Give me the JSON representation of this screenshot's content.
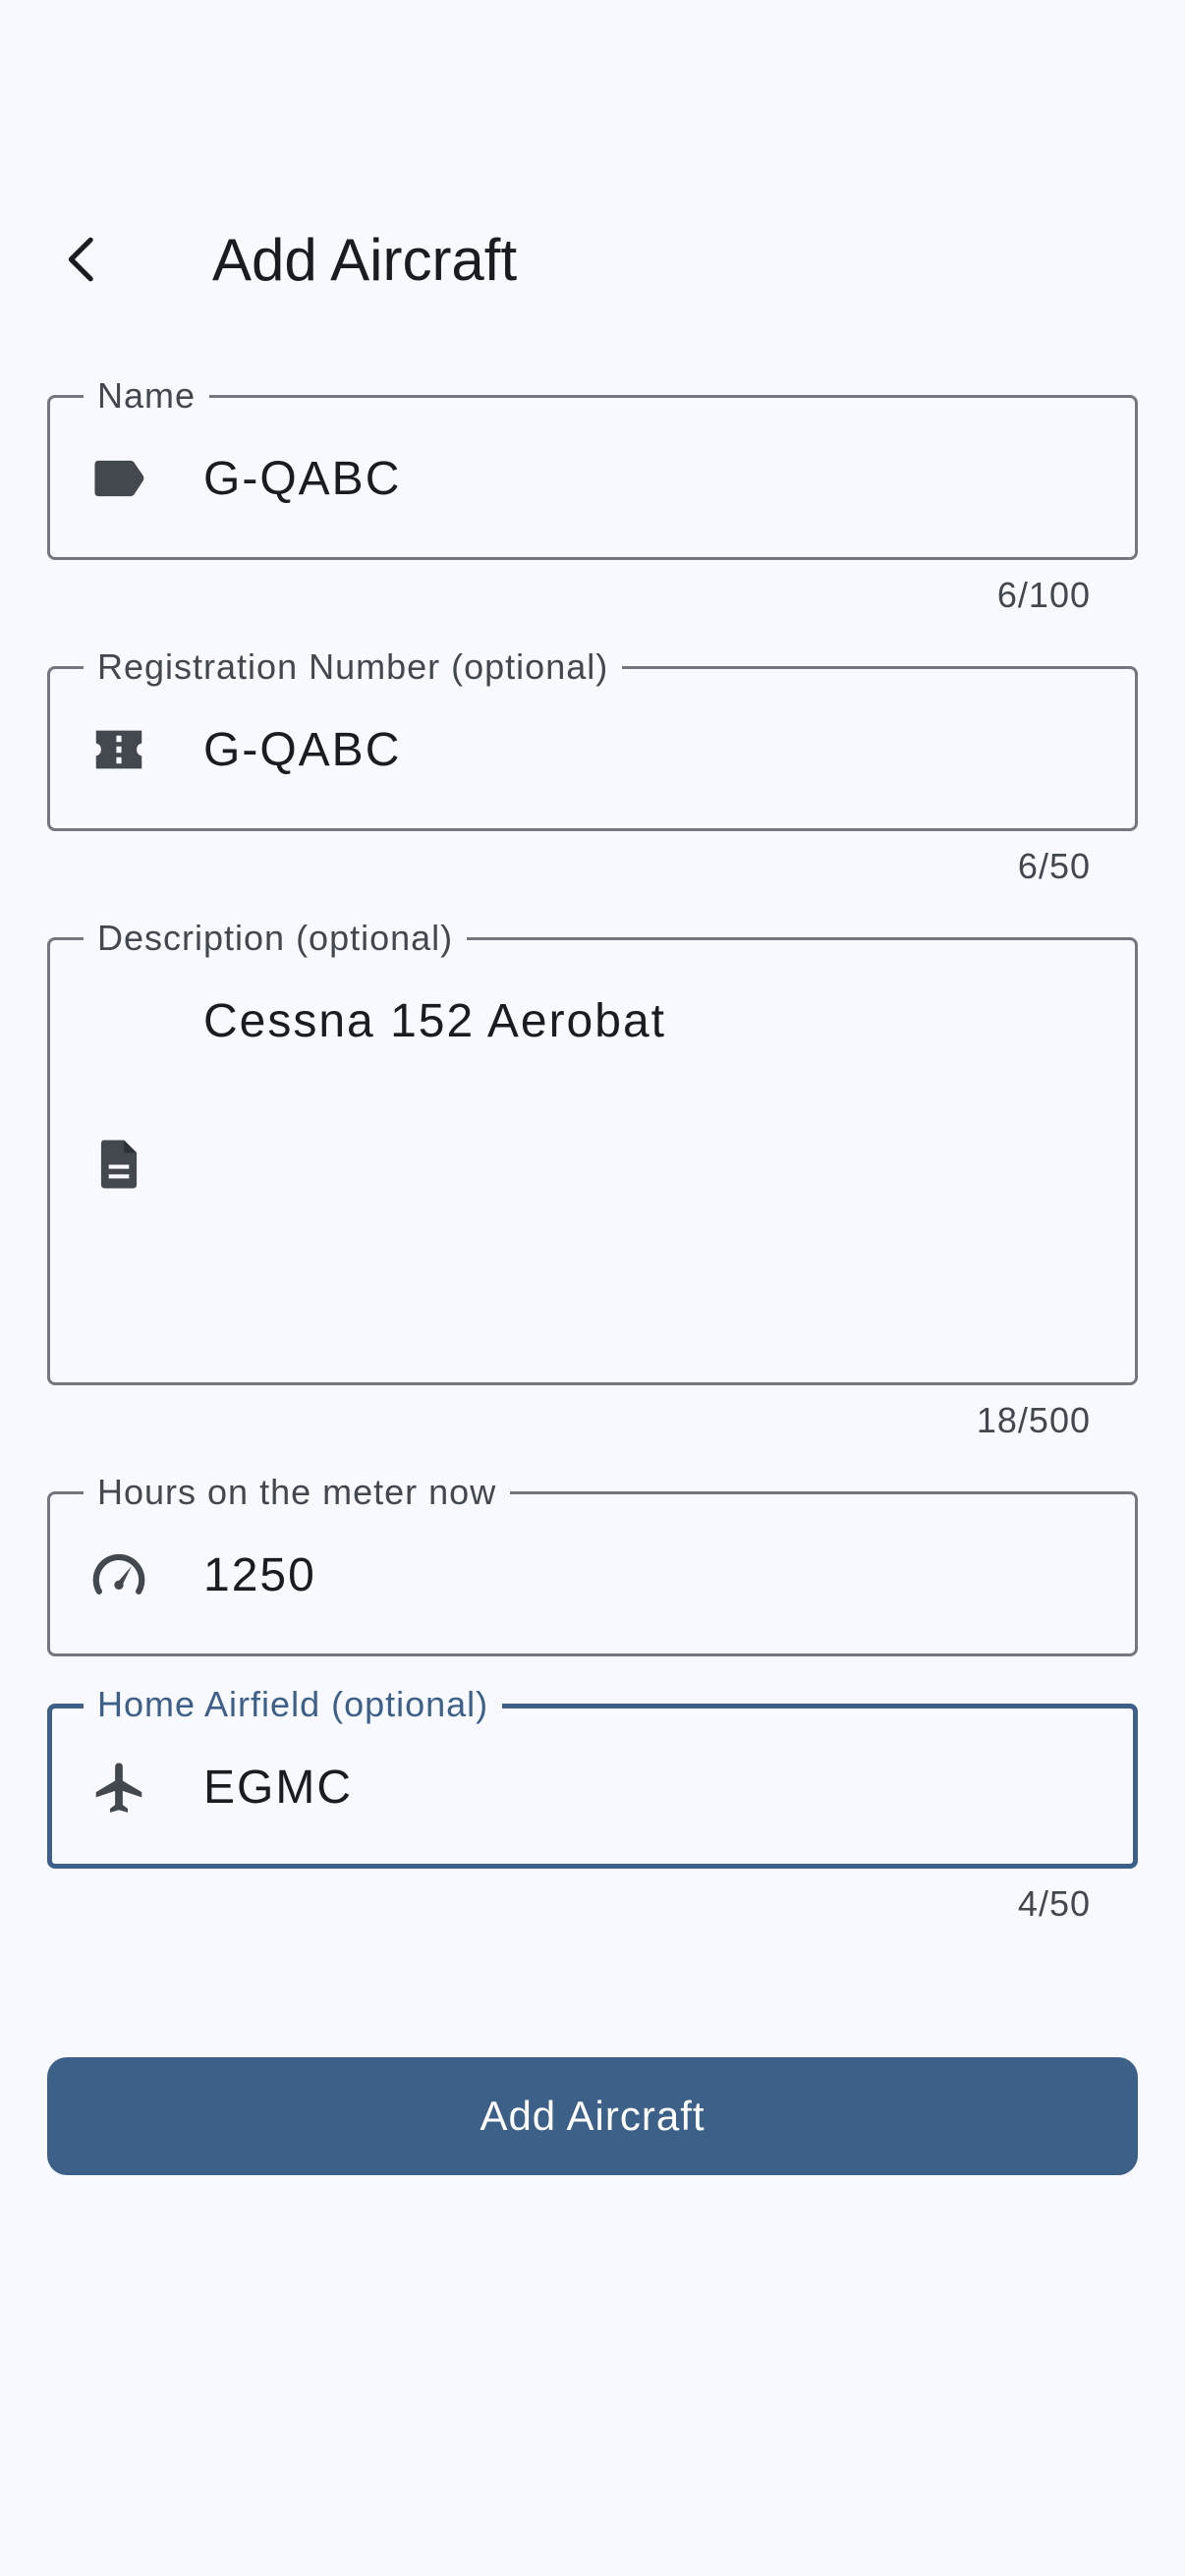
{
  "header": {
    "back_icon": "chevron-left-icon",
    "title": "Add Aircraft"
  },
  "fields": {
    "name": {
      "label": "Name",
      "value": "G-QABC",
      "counter": "6/100",
      "icon": "label-icon"
    },
    "registration": {
      "label": "Registration Number (optional)",
      "value": "G-QABC",
      "counter": "6/50",
      "icon": "ticket-icon"
    },
    "description": {
      "label": "Description (optional)",
      "value": "Cessna 152 Aerobat",
      "counter": "18/500",
      "icon": "document-icon"
    },
    "hours": {
      "label": "Hours on the meter now",
      "value": "1250",
      "icon": "speedometer-icon"
    },
    "home_airfield": {
      "label": "Home Airfield (optional)",
      "value": "EGMC",
      "counter": "4/50",
      "icon": "airplane-icon",
      "focused": true
    }
  },
  "submit_label": "Add Aircraft",
  "colors": {
    "background": "#f7f9ff",
    "primary": "#3d6089",
    "outline": "#73777f",
    "icon": "#43474e",
    "text": "#191c20"
  }
}
